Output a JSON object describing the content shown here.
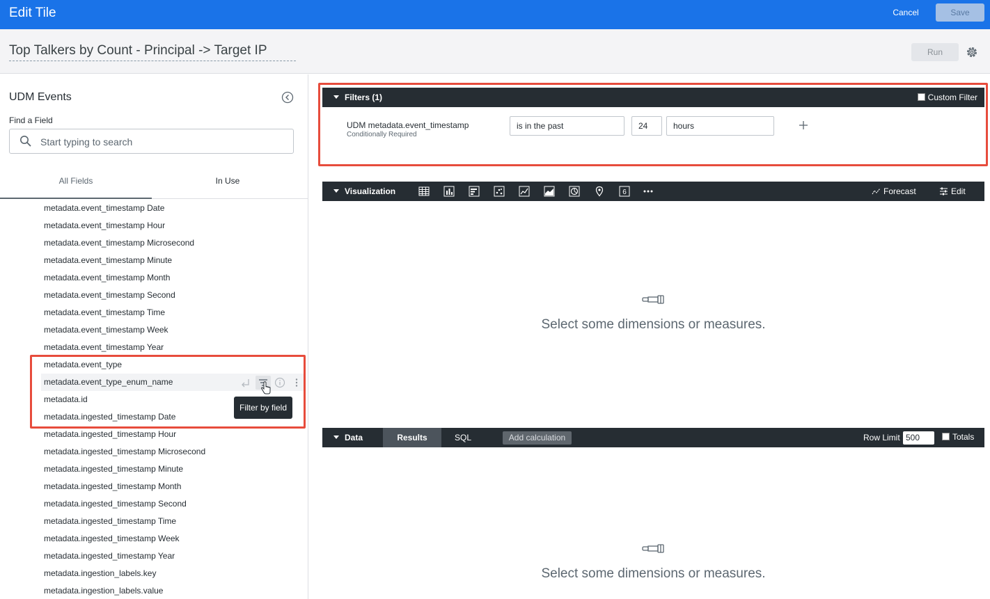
{
  "header": {
    "title": "Edit Tile",
    "cancel_label": "Cancel",
    "save_label": "Save"
  },
  "tile": {
    "title": "Top Talkers by Count - Principal -> Target IP",
    "run_label": "Run"
  },
  "left_panel": {
    "title": "UDM Events",
    "find_label": "Find a Field",
    "search_placeholder": "Start typing to search",
    "tabs": [
      {
        "label": "All Fields"
      },
      {
        "label": "In Use"
      }
    ],
    "fields": [
      "metadata.event_timestamp Date",
      "metadata.event_timestamp Hour",
      "metadata.event_timestamp Microsecond",
      "metadata.event_timestamp Minute",
      "metadata.event_timestamp Month",
      "metadata.event_timestamp Second",
      "metadata.event_timestamp Time",
      "metadata.event_timestamp Week",
      "metadata.event_timestamp Year",
      "metadata.event_type",
      "metadata.event_type_enum_name",
      "metadata.id",
      "metadata.ingested_timestamp Date",
      "metadata.ingested_timestamp Hour",
      "metadata.ingested_timestamp Microsecond",
      "metadata.ingested_timestamp Minute",
      "metadata.ingested_timestamp Month",
      "metadata.ingested_timestamp Second",
      "metadata.ingested_timestamp Time",
      "metadata.ingested_timestamp Week",
      "metadata.ingested_timestamp Year",
      "metadata.ingestion_labels.key",
      "metadata.ingestion_labels.value"
    ],
    "tooltip": "Filter by field"
  },
  "filters": {
    "label": "Filters (1)",
    "custom_filter_label": "Custom Filter",
    "field": "UDM metadata.event_timestamp",
    "field_note": "Conditionally Required",
    "operator": "is in the past",
    "value": "24",
    "unit": "hours"
  },
  "visualization": {
    "label": "Visualization",
    "forecast_label": "Forecast",
    "edit_label": "Edit",
    "empty_text": "Select some dimensions or measures."
  },
  "data": {
    "label": "Data",
    "results_label": "Results",
    "sql_label": "SQL",
    "add_calc_label": "Add calculation",
    "row_limit_label": "Row Limit",
    "row_limit_value": "500",
    "totals_label": "Totals",
    "empty_text": "Select some dimensions or measures."
  },
  "colors": {
    "brand": "#1a73e8",
    "dark_bar": "#262d33",
    "highlight": "#e74c3c"
  }
}
